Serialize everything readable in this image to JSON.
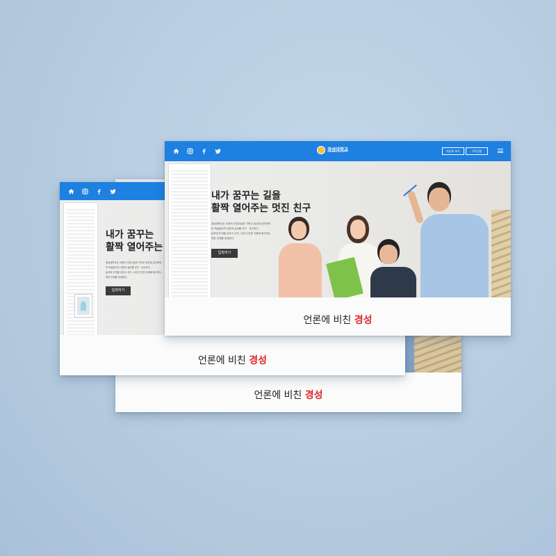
{
  "colors": {
    "background": "#b7cde0",
    "nav_blue": "#1e80e0",
    "accent_red": "#e0262a",
    "button_dark": "#3a3a3a"
  },
  "nav": {
    "icons": [
      "home-icon",
      "instagram-icon",
      "facebook-icon",
      "twitter-icon"
    ],
    "logo": {
      "name": "경성대학교",
      "subtitle": "KYUNGSUNG UNIVERSITY"
    },
    "buttons": [
      "지난호 보기",
      "구독신청"
    ]
  },
  "hero": {
    "headline_line1": "내가 꿈꾸는 길을",
    "headline_line2": "활짝 열어주는 멋진 친구",
    "left_headline_line1": "내가 꿈꾸는 ",
    "left_headline_line2": "활짝 열어주는",
    "body": "경성대학교는 교육의 근본이념과 기독교 정신에 입각하여\n의 학술분야의 이론과 실무를 연구 · 교수하고,\n능력과 인격을 갖추고 국가, 나아가 인류 사회에 봉사하는\n전문 인재를 양성한다.",
    "cta": "입학하기"
  },
  "footer": {
    "text": "언론에 비친 ",
    "highlight": "경성"
  }
}
